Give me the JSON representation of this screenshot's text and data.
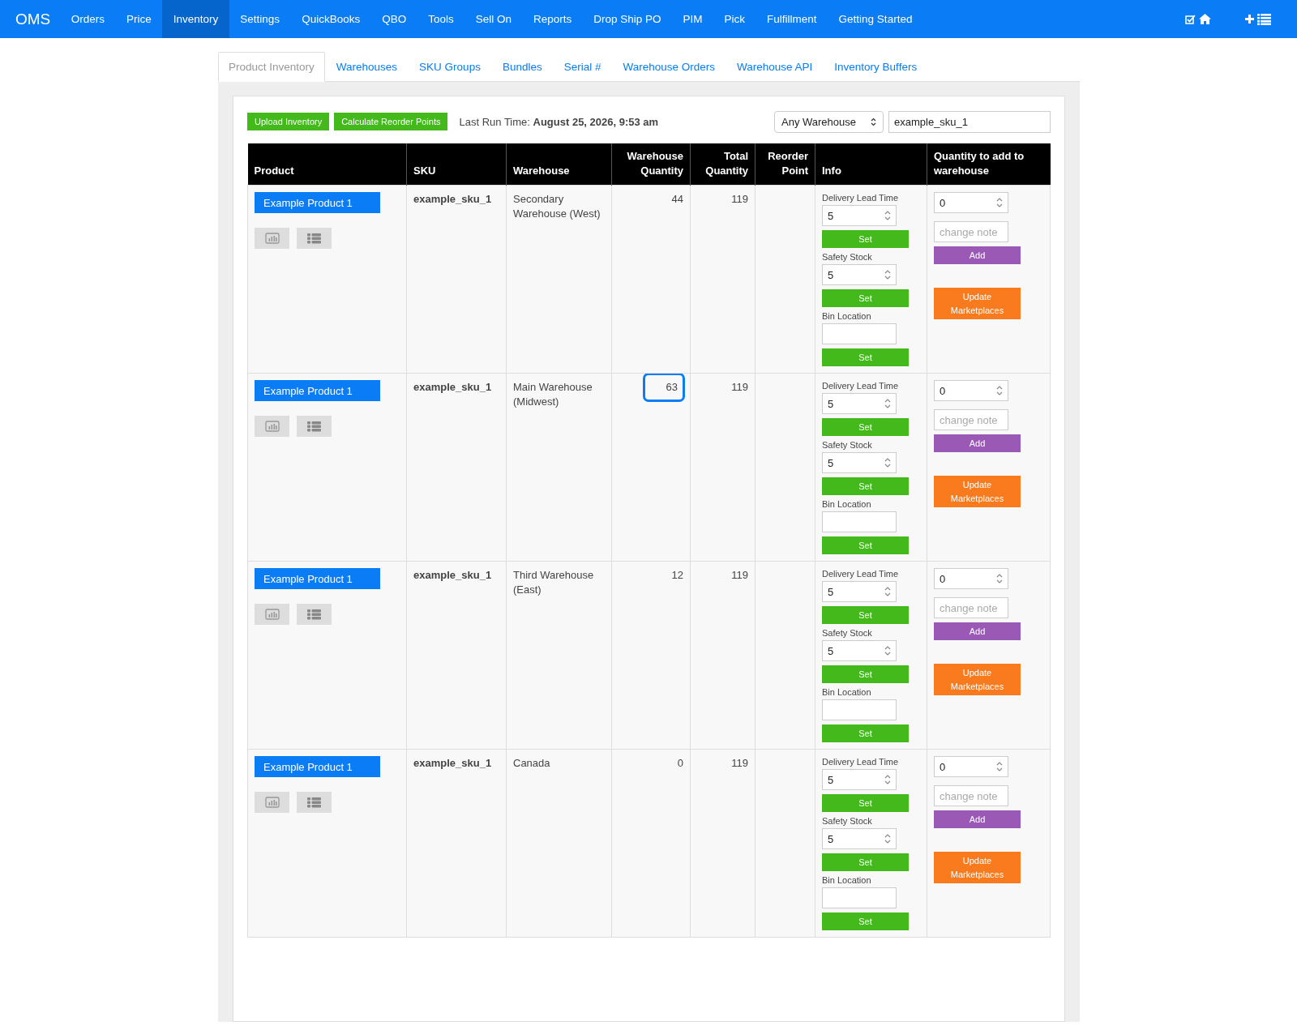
{
  "nav": {
    "brand": "OMS",
    "items": [
      {
        "label": "Orders",
        "selected": false
      },
      {
        "label": "Price",
        "selected": false
      },
      {
        "label": "Inventory",
        "selected": true
      },
      {
        "label": "Settings",
        "selected": false
      },
      {
        "label": "QuickBooks",
        "selected": false
      },
      {
        "label": "QBO",
        "selected": false
      },
      {
        "label": "Tools",
        "selected": false
      },
      {
        "label": "Sell On",
        "selected": false
      },
      {
        "label": "Reports",
        "selected": false
      },
      {
        "label": "Drop Ship PO",
        "selected": false
      },
      {
        "label": "PIM",
        "selected": false
      },
      {
        "label": "Pick",
        "selected": false
      },
      {
        "label": "Fulfillment",
        "selected": false
      },
      {
        "label": "Getting Started",
        "selected": false
      }
    ]
  },
  "tabs": [
    {
      "label": "Product Inventory",
      "selected": true
    },
    {
      "label": "Warehouses",
      "selected": false
    },
    {
      "label": "SKU Groups",
      "selected": false
    },
    {
      "label": "Bundles",
      "selected": false
    },
    {
      "label": "Serial #",
      "selected": false
    },
    {
      "label": "Warehouse Orders",
      "selected": false
    },
    {
      "label": "Warehouse API",
      "selected": false
    },
    {
      "label": "Inventory Buffers",
      "selected": false
    }
  ],
  "toolbar": {
    "buttons": [
      "Upload Inventory",
      "Calculate Reorder Points"
    ],
    "last_run_label": "Last Run Time:",
    "last_run_value": "August 25, 2026, 9:53 am",
    "warehouse_select": "Any Warehouse",
    "sku_search": "example_sku_1"
  },
  "table": {
    "columns": [
      "Product",
      "SKU",
      "Warehouse",
      "Warehouse Quantity",
      "Total Quantity",
      "Reorder Point",
      "Info",
      "Quantity to add to warehouse"
    ],
    "rows": [
      {
        "product": "Example Product 1",
        "sku": "example_sku_1",
        "warehouse": "Secondary Warehouse (West)",
        "warehouse_quantity": "44",
        "total_quantity": "119",
        "highlighted": false,
        "info": [
          {
            "label": "Delivery Lead Time",
            "value": "5",
            "kind": "number",
            "button": "Set"
          },
          {
            "label": "Safety Stock",
            "value": "5",
            "kind": "number",
            "button": "Set"
          },
          {
            "label": "Bin Location",
            "kind": "text",
            "button": "Set"
          }
        ],
        "add_quantity": "0",
        "note_placeholder": "change note",
        "add_button": "Add",
        "update_button": "Update Marketplaces"
      },
      {
        "product": "Example Product 1",
        "sku": "example_sku_1",
        "warehouse": "Main Warehouse (Midwest)",
        "warehouse_quantity": "63",
        "total_quantity": "119",
        "highlighted": true,
        "info": [
          {
            "label": "Delivery Lead Time",
            "value": "5",
            "kind": "number",
            "button": "Set"
          },
          {
            "label": "Safety Stock",
            "value": "5",
            "kind": "number",
            "button": "Set"
          },
          {
            "label": "Bin Location",
            "kind": "text",
            "button": "Set"
          }
        ],
        "add_quantity": "0",
        "note_placeholder": "change note",
        "add_button": "Add",
        "update_button": "Update Marketplaces"
      },
      {
        "product": "Example Product 1",
        "sku": "example_sku_1",
        "warehouse": "Third Warehouse (East)",
        "warehouse_quantity": "12",
        "total_quantity": "119",
        "highlighted": false,
        "info": [
          {
            "label": "Delivery Lead Time",
            "value": "5",
            "kind": "number",
            "button": "Set"
          },
          {
            "label": "Safety Stock",
            "value": "5",
            "kind": "number",
            "button": "Set"
          },
          {
            "label": "Bin Location",
            "kind": "text",
            "button": "Set"
          }
        ],
        "add_quantity": "0",
        "note_placeholder": "change note",
        "add_button": "Add",
        "update_button": "Update Marketplaces"
      },
      {
        "product": "Example Product 1",
        "sku": "example_sku_1",
        "warehouse": "Canada",
        "warehouse_quantity": "0",
        "total_quantity": "119",
        "highlighted": false,
        "info": [
          {
            "label": "Delivery Lead Time",
            "value": "5",
            "kind": "number",
            "button": "Set"
          },
          {
            "label": "Safety Stock",
            "value": "5",
            "kind": "number",
            "button": "Set"
          },
          {
            "label": "Bin Location",
            "kind": "text",
            "button": "Set"
          }
        ],
        "add_quantity": "0",
        "note_placeholder": "change note",
        "add_button": "Add",
        "update_button": "Update Marketplaces"
      }
    ]
  }
}
